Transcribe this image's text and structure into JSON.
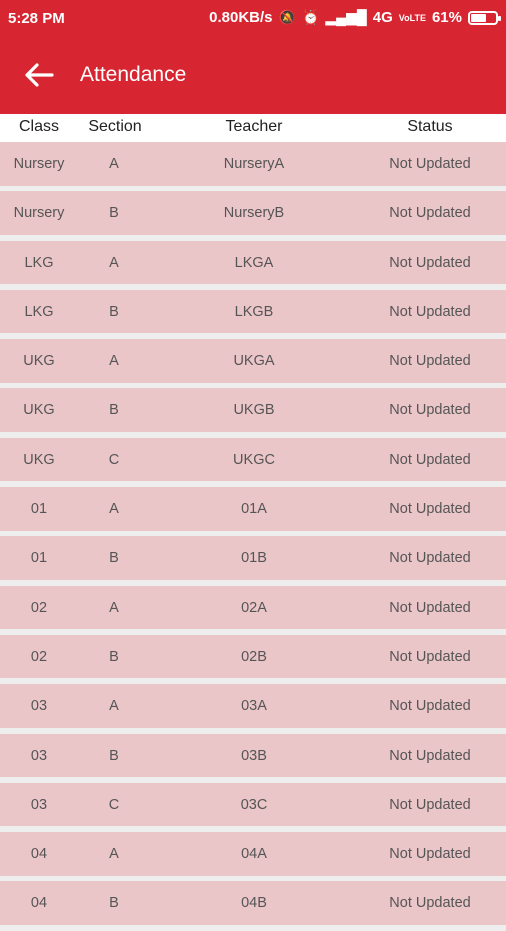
{
  "status_bar": {
    "time": "5:28 PM",
    "speed": "0.80KB/s",
    "network": "4G",
    "volte": "VoLTE",
    "battery_text": "61%",
    "battery_level": 0.61
  },
  "app_bar": {
    "title": "Attendance",
    "back_icon": "arrow-left-icon",
    "color": "#d72631"
  },
  "table": {
    "headers": [
      "Class",
      "Section",
      "Teacher",
      "Status"
    ],
    "rows": [
      [
        "Nursery",
        "A",
        "NurseryA",
        "Not Updated"
      ],
      [
        "Nursery",
        "B",
        "NurseryB",
        "Not Updated"
      ],
      [
        "LKG",
        "A",
        "LKGA",
        "Not Updated"
      ],
      [
        "LKG",
        "B",
        "LKGB",
        "Not Updated"
      ],
      [
        "UKG",
        "A",
        "UKGA",
        "Not Updated"
      ],
      [
        "UKG",
        "B",
        "UKGB",
        "Not Updated"
      ],
      [
        "UKG",
        "C",
        "UKGC",
        "Not Updated"
      ],
      [
        "01",
        "A",
        "01A",
        "Not Updated"
      ],
      [
        "01",
        "B",
        "01B",
        "Not Updated"
      ],
      [
        "02",
        "A",
        "02A",
        "Not Updated"
      ],
      [
        "02",
        "B",
        "02B",
        "Not Updated"
      ],
      [
        "03",
        "A",
        "03A",
        "Not Updated"
      ],
      [
        "03",
        "B",
        "03B",
        "Not Updated"
      ],
      [
        "03",
        "C",
        "03C",
        "Not Updated"
      ],
      [
        "04",
        "A",
        "04A",
        "Not Updated"
      ],
      [
        "04",
        "B",
        "04B",
        "Not Updated"
      ]
    ],
    "row_color": "#ebc6c9"
  }
}
